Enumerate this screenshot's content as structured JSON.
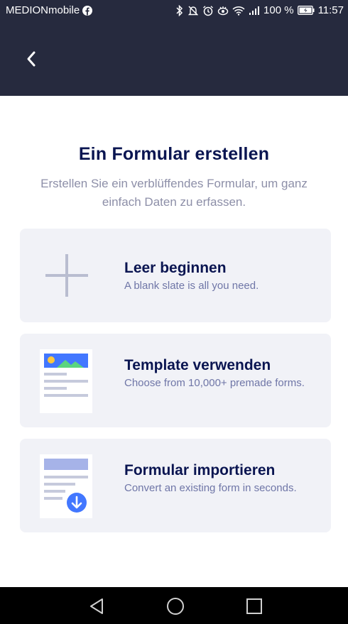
{
  "status_bar": {
    "carrier": "MEDIONmobile",
    "battery": "100 %",
    "time": "11:57"
  },
  "header": {
    "back_icon": "chevron-left-icon"
  },
  "main": {
    "title": "Ein Formular erstellen",
    "subtitle": "Erstellen Sie ein verblüffendes Formular, um ganz einfach Daten zu erfassen."
  },
  "cards": [
    {
      "icon": "plus-icon",
      "title": "Leer beginnen",
      "description": "A blank slate is all you need."
    },
    {
      "icon": "template-icon",
      "title": "Template verwenden",
      "description": "Choose from 10,000+ premade forms."
    },
    {
      "icon": "import-icon",
      "title": "Formular importieren",
      "description": "Convert an existing form in seconds."
    }
  ],
  "colors": {
    "header_bg": "#262a3e",
    "title": "#0a1551",
    "subtitle": "#8d8fa8",
    "card_bg": "#f1f2f7",
    "accent_blue": "#4277ff"
  }
}
